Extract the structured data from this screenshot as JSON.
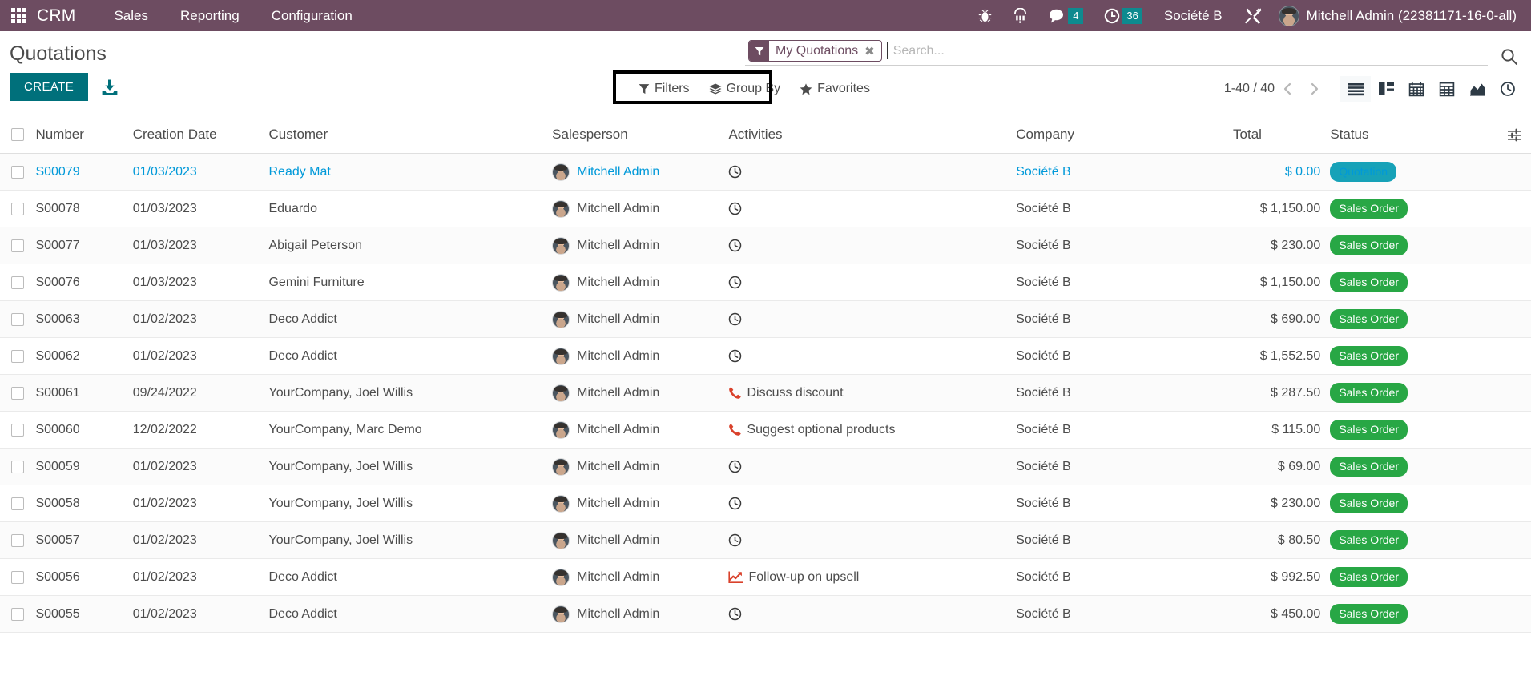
{
  "navbar": {
    "apps_icon": "apps-grid-icon",
    "brand": "CRM",
    "menus": [
      {
        "label": "Sales"
      },
      {
        "label": "Reporting"
      },
      {
        "label": "Configuration"
      }
    ],
    "icons": [
      {
        "name": "bug-icon",
        "badge": ""
      },
      {
        "name": "voip-dialpad-icon",
        "badge": ""
      },
      {
        "name": "messaging-chat-icon",
        "badge": "4"
      },
      {
        "name": "activities-clock-icon",
        "badge": "36"
      }
    ],
    "company": "Société B",
    "developer_tools_icon": "tools-wrench-screwdriver-icon",
    "user": "Mitchell Admin (22381171-16-0-all)"
  },
  "control_panel": {
    "title": "Quotations",
    "create_label": "CREATE",
    "import_icon": "import-download-icon",
    "search": {
      "facet_label": "My Quotations",
      "facet_icon": "filter-funnel-icon",
      "facet_remove": "✖",
      "placeholder": "Search...",
      "value": "",
      "submit_icon": "search-magnifier-icon"
    },
    "dropdowns": [
      {
        "label": "Filters",
        "icon": "filter-funnel-icon"
      },
      {
        "label": "Group By",
        "icon": "layers-stack-icon"
      },
      {
        "label": "Favorites",
        "icon": "star-icon"
      }
    ],
    "pager": {
      "value": "1-40 / 40",
      "prev_icon": "chevron-left-icon",
      "next_icon": "chevron-right-icon"
    },
    "views": [
      {
        "name": "list-view",
        "icon": "list-icon",
        "active": true
      },
      {
        "name": "kanban-view",
        "icon": "kanban-icon",
        "active": false
      },
      {
        "name": "calendar-view",
        "icon": "calendar-icon",
        "active": false
      },
      {
        "name": "pivot-view",
        "icon": "pivot-table-icon",
        "active": false
      },
      {
        "name": "graph-view",
        "icon": "graph-area-icon",
        "active": false
      },
      {
        "name": "activity-view",
        "icon": "clock-icon",
        "active": false
      }
    ]
  },
  "table": {
    "columns": [
      {
        "key": "number",
        "label": "Number"
      },
      {
        "key": "creation",
        "label": "Creation Date"
      },
      {
        "key": "customer",
        "label": "Customer"
      },
      {
        "key": "salesperson",
        "label": "Salesperson"
      },
      {
        "key": "activities",
        "label": "Activities"
      },
      {
        "key": "company",
        "label": "Company"
      },
      {
        "key": "total",
        "label": "Total"
      },
      {
        "key": "status",
        "label": "Status"
      }
    ],
    "optional_columns_icon": "column-settings-sliders-icon",
    "rows": [
      {
        "number": "S00079",
        "creation": "01/03/2023",
        "customer": "Ready Mat",
        "salesperson": "Mitchell Admin",
        "activity": "",
        "activity_icon": "clock-icon",
        "company": "Société B",
        "total": "$ 0.00",
        "status": "Quotation",
        "status_type": "quotation",
        "highlight": true
      },
      {
        "number": "S00078",
        "creation": "01/03/2023",
        "customer": "Eduardo",
        "salesperson": "Mitchell Admin",
        "activity": "",
        "activity_icon": "clock-icon",
        "company": "Société B",
        "total": "$ 1,150.00",
        "status": "Sales Order",
        "status_type": "salesorder",
        "highlight": false
      },
      {
        "number": "S00077",
        "creation": "01/03/2023",
        "customer": "Abigail Peterson",
        "salesperson": "Mitchell Admin",
        "activity": "",
        "activity_icon": "clock-icon",
        "company": "Société B",
        "total": "$ 230.00",
        "status": "Sales Order",
        "status_type": "salesorder",
        "highlight": false
      },
      {
        "number": "S00076",
        "creation": "01/03/2023",
        "customer": "Gemini Furniture",
        "salesperson": "Mitchell Admin",
        "activity": "",
        "activity_icon": "clock-icon",
        "company": "Société B",
        "total": "$ 1,150.00",
        "status": "Sales Order",
        "status_type": "salesorder",
        "highlight": false
      },
      {
        "number": "S00063",
        "creation": "01/02/2023",
        "customer": "Deco Addict",
        "salesperson": "Mitchell Admin",
        "activity": "",
        "activity_icon": "clock-icon",
        "company": "Société B",
        "total": "$ 690.00",
        "status": "Sales Order",
        "status_type": "salesorder",
        "highlight": false
      },
      {
        "number": "S00062",
        "creation": "01/02/2023",
        "customer": "Deco Addict",
        "salesperson": "Mitchell Admin",
        "activity": "",
        "activity_icon": "clock-icon",
        "company": "Société B",
        "total": "$ 1,552.50",
        "status": "Sales Order",
        "status_type": "salesorder",
        "highlight": false
      },
      {
        "number": "S00061",
        "creation": "09/24/2022",
        "customer": "YourCompany, Joel Willis",
        "salesperson": "Mitchell Admin",
        "activity": "Discuss discount",
        "activity_icon": "phone-call-icon",
        "company": "Société B",
        "total": "$ 287.50",
        "status": "Sales Order",
        "status_type": "salesorder",
        "highlight": false
      },
      {
        "number": "S00060",
        "creation": "12/02/2022",
        "customer": "YourCompany, Marc Demo",
        "salesperson": "Mitchell Admin",
        "activity": "Suggest optional products",
        "activity_icon": "phone-call-icon",
        "company": "Société B",
        "total": "$ 115.00",
        "status": "Sales Order",
        "status_type": "salesorder",
        "highlight": false
      },
      {
        "number": "S00059",
        "creation": "01/02/2023",
        "customer": "YourCompany, Joel Willis",
        "salesperson": "Mitchell Admin",
        "activity": "",
        "activity_icon": "clock-icon",
        "company": "Société B",
        "total": "$ 69.00",
        "status": "Sales Order",
        "status_type": "salesorder",
        "highlight": false
      },
      {
        "number": "S00058",
        "creation": "01/02/2023",
        "customer": "YourCompany, Joel Willis",
        "salesperson": "Mitchell Admin",
        "activity": "",
        "activity_icon": "clock-icon",
        "company": "Société B",
        "total": "$ 230.00",
        "status": "Sales Order",
        "status_type": "salesorder",
        "highlight": false
      },
      {
        "number": "S00057",
        "creation": "01/02/2023",
        "customer": "YourCompany, Joel Willis",
        "salesperson": "Mitchell Admin",
        "activity": "",
        "activity_icon": "clock-icon",
        "company": "Société B",
        "total": "$ 80.50",
        "status": "Sales Order",
        "status_type": "salesorder",
        "highlight": false
      },
      {
        "number": "S00056",
        "creation": "01/02/2023",
        "customer": "Deco Addict",
        "salesperson": "Mitchell Admin",
        "activity": "Follow-up on upsell",
        "activity_icon": "upsell-chart-icon",
        "company": "Société B",
        "total": "$ 992.50",
        "status": "Sales Order",
        "status_type": "salesorder",
        "highlight": false
      },
      {
        "number": "S00055",
        "creation": "01/02/2023",
        "customer": "Deco Addict",
        "salesperson": "Mitchell Admin",
        "activity": "",
        "activity_icon": "clock-icon",
        "company": "Société B",
        "total": "$ 450.00",
        "status": "Sales Order",
        "status_type": "salesorder",
        "highlight": false
      }
    ]
  },
  "colors": {
    "navbar_bg": "#6d4c61",
    "create_btn": "#00707b",
    "badge_teal": "#0e8a8f",
    "status_quotation": "#17a2b8",
    "status_salesorder": "#28a745",
    "link_blue": "#0099d9",
    "annotation_box": "#000000"
  }
}
